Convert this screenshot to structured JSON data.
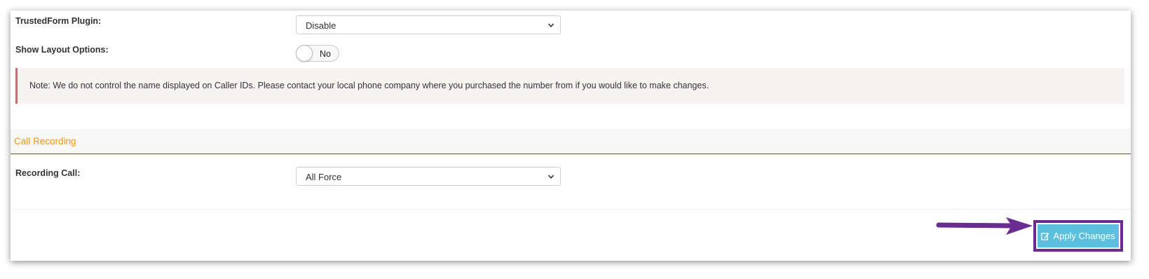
{
  "settings": {
    "trustedform": {
      "label": "TrustedForm Plugin:",
      "value": "Disable"
    },
    "show_layout": {
      "label": "Show Layout Options:",
      "toggle_text": "No"
    },
    "note": "Note: We do not control the name displayed on Caller IDs. Please contact your local phone company where you purchased the number from if you would like to make changes."
  },
  "call_recording": {
    "section_title": "Call Recording",
    "recording_call": {
      "label": "Recording Call:",
      "value": "All Force"
    }
  },
  "footer": {
    "apply_label": "Apply Changes"
  },
  "colors": {
    "section_title": "#f0960f",
    "section_divider": "#6b3e8e",
    "button": "#5bc0de",
    "highlight": "#6a2c8e",
    "note_border": "#c96e6e"
  },
  "icons": {
    "select_chevron": "chevron-down-icon",
    "apply": "edit-icon",
    "annotation": "arrow-right-icon"
  }
}
